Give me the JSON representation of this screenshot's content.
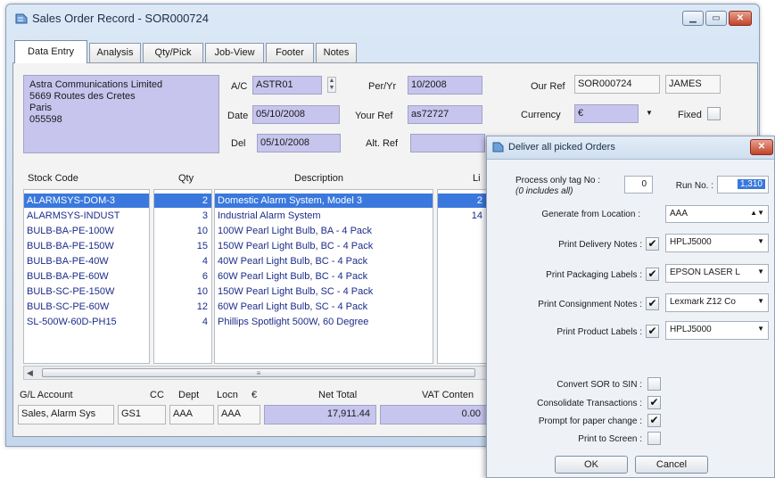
{
  "window": {
    "title": "Sales Order Record - SOR000724"
  },
  "tabs": [
    "Data Entry",
    "Analysis",
    "Qty/Pick",
    "Job-View",
    "Footer",
    "Notes"
  ],
  "customer": {
    "name": "Astra Communications Limited",
    "address": "5669 Routes des Cretes",
    "city": "Paris",
    "code": "055598"
  },
  "form": {
    "ac_label": "A/C",
    "ac_value": "ASTR01",
    "date_label": "Date",
    "date_value": "05/10/2008",
    "del_label": "Del",
    "del_value": "05/10/2008",
    "peryr_label": "Per/Yr",
    "peryr_value": "10/2008",
    "yourref_label": "Your Ref",
    "yourref_value": "as72727",
    "altref_label": "Alt. Ref",
    "altref_value": "",
    "ourref_label": "Our Ref",
    "ourref_value": "SOR000724",
    "ourref_user": "JAMES",
    "currency_label": "Currency",
    "currency_value": "€",
    "fixed_label": "Fixed"
  },
  "lines": {
    "headers": {
      "stock_code": "Stock Code",
      "qty": "Qty",
      "description": "Description",
      "line": "Li"
    },
    "rows": [
      {
        "code": "ALARMSYS-DOM-3",
        "qty": "2",
        "desc": "Domestic Alarm System, Model 3",
        "line": "2",
        "selected": true
      },
      {
        "code": "ALARMSYS-INDUST",
        "qty": "3",
        "desc": "Industrial Alarm System",
        "line": "14",
        "selected": false
      },
      {
        "code": "BULB-BA-PE-100W",
        "qty": "10",
        "desc": "100W Pearl Light Bulb, BA - 4 Pack",
        "line": "",
        "selected": false
      },
      {
        "code": "BULB-BA-PE-150W",
        "qty": "15",
        "desc": "150W Pearl Light Bulb, BC - 4 Pack",
        "line": "",
        "selected": false
      },
      {
        "code": "BULB-BA-PE-40W",
        "qty": "4",
        "desc": "40W Pearl Light Bulb, BC - 4 Pack",
        "line": "",
        "selected": false
      },
      {
        "code": "BULB-BA-PE-60W",
        "qty": "6",
        "desc": "60W Pearl Light Bulb, BC - 4 Pack",
        "line": "",
        "selected": false
      },
      {
        "code": "BULB-SC-PE-150W",
        "qty": "10",
        "desc": "150W Pearl Light Bulb, SC - 4 Pack",
        "line": "",
        "selected": false
      },
      {
        "code": "BULB-SC-PE-60W",
        "qty": "12",
        "desc": "60W Pearl Light Bulb, SC - 4 Pack",
        "line": "",
        "selected": false
      },
      {
        "code": "SL-500W-60D-PH15",
        "qty": "4",
        "desc": "Phillips Spotlight 500W, 60 Degree",
        "line": "",
        "selected": false
      }
    ]
  },
  "footer": {
    "gl_label": "G/L Account",
    "gl_value": "Sales, Alarm Sys",
    "cc_label": "CC",
    "cc_value": "GS1",
    "dept_label": "Dept",
    "dept_value": "AAA",
    "locn_label": "Locn",
    "locn_value": "AAA",
    "currency_symbol": "€",
    "net_label": "Net Total",
    "net_value": "17,911.44",
    "vat_label": "VAT Conten",
    "vat_value": "0.00"
  },
  "dialog": {
    "title": "Deliver all picked Orders",
    "process_tag_label": "Process only tag No :",
    "process_tag_note": "(0 includes all)",
    "process_tag_value": "0",
    "run_no_label": "Run No. :",
    "run_no_value": "1,310",
    "generate_label": "Generate from Location :",
    "generate_value": "AAA",
    "print_options": [
      {
        "label": "Print Delivery Notes :",
        "checked": "✔",
        "printer": "HPLJ5000"
      },
      {
        "label": "Print Packaging Labels :",
        "checked": "✔",
        "printer": "EPSON LASER L"
      },
      {
        "label": "Print Consignment Notes :",
        "checked": "✔",
        "printer": "Lexmark Z12 Co"
      },
      {
        "label": "Print Product Labels :",
        "checked": "✔",
        "printer": "HPLJ5000"
      }
    ],
    "flags": [
      {
        "label": "Convert SOR to SIN :",
        "checked": ""
      },
      {
        "label": "Consolidate Transactions :",
        "checked": "✔"
      },
      {
        "label": "Prompt for paper change :",
        "checked": "✔"
      },
      {
        "label": "Print to Screen :",
        "checked": ""
      }
    ],
    "ok_label": "OK",
    "cancel_label": "Cancel"
  },
  "colors": {
    "selection": "#3a78dd",
    "field_lavender": "#c7c5ee",
    "list_text": "#1c2c8a"
  }
}
